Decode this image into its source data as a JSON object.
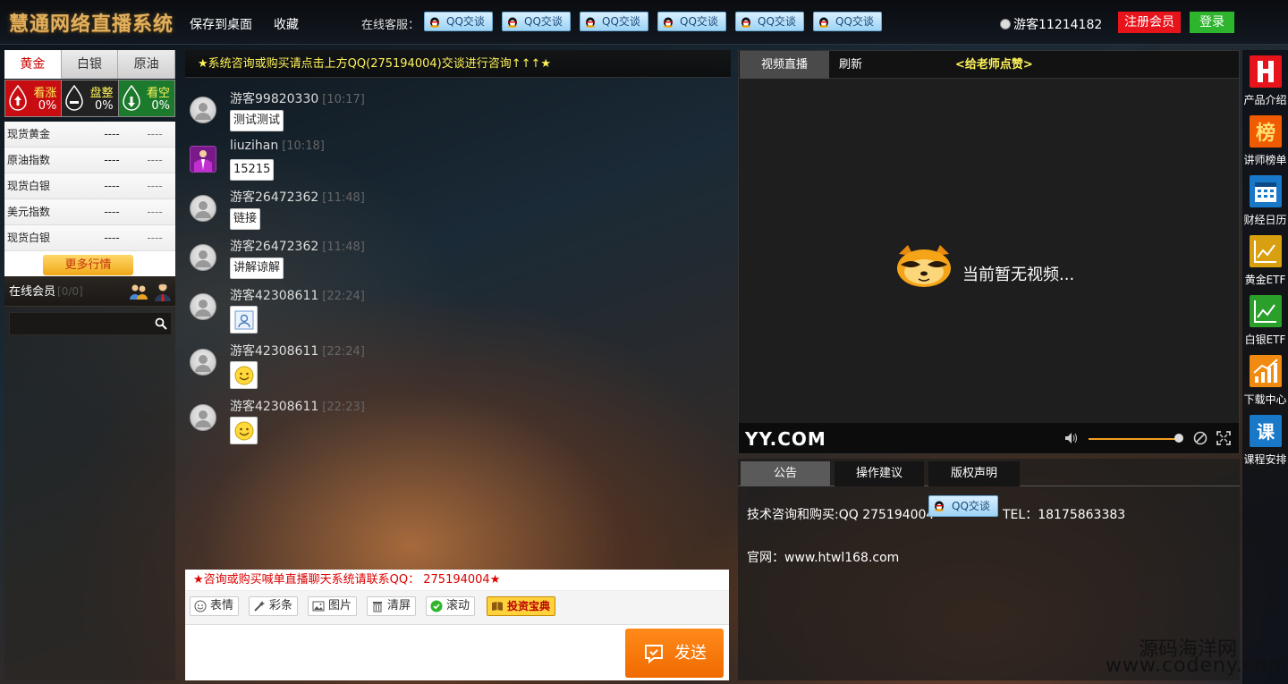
{
  "header": {
    "logo": "慧通网络直播系统",
    "save_desktop": "保存到桌面",
    "favorite": "收藏",
    "online_service_label": "在线客服：",
    "qq_buttons": [
      "QQ交谈",
      "QQ交谈",
      "QQ交谈",
      "QQ交谈",
      "QQ交谈",
      "QQ交谈"
    ],
    "username": "游客11214182",
    "register": "注册会员",
    "login": "登录"
  },
  "market": {
    "tabs": [
      "黄金",
      "白银",
      "原油"
    ],
    "active_tab": 0,
    "sentiment": [
      {
        "label": "看涨",
        "pct": "0%"
      },
      {
        "label": "盘整",
        "pct": "0%"
      },
      {
        "label": "看空",
        "pct": "0%"
      }
    ],
    "quotes": [
      {
        "name": "现货黄金",
        "value": "----",
        "change": "----"
      },
      {
        "name": "原油指数",
        "value": "----",
        "change": "----"
      },
      {
        "name": "现货白银",
        "value": "----",
        "change": "----"
      },
      {
        "name": "美元指数",
        "value": "----",
        "change": "----"
      },
      {
        "name": "现货白银",
        "value": "----",
        "change": "----"
      }
    ],
    "more": "更多行情"
  },
  "members": {
    "title": "在线会员",
    "count": "[0/0]",
    "search_placeholder": ""
  },
  "chat": {
    "notice": "★系统咨询或购买请点击上方QQ(275194004)交谈进行咨询↑↑↑★",
    "messages": [
      {
        "user": "游客99820330",
        "time": "[10:17]",
        "text": "测试测试",
        "type": "text"
      },
      {
        "user": "liuzihan",
        "time": "[10:18]",
        "text": "15215",
        "type": "text"
      },
      {
        "user": "游客26472362",
        "time": "[11:48]",
        "text": "链接",
        "type": "text"
      },
      {
        "user": "游客26472362",
        "time": "[11:48]",
        "text": "讲解谅解",
        "type": "text"
      },
      {
        "user": "游客42308611",
        "time": "[22:24]",
        "text": "",
        "type": "image"
      },
      {
        "user": "游客42308611",
        "time": "[22:24]",
        "text": "",
        "type": "emoji"
      },
      {
        "user": "游客42308611",
        "time": "[22:23]",
        "text": "",
        "type": "emoji"
      }
    ],
    "footer_notice": "★咨询或购买喊单直播聊天系统请联系QQ： 275194004★",
    "tools": [
      "表情",
      "彩条",
      "图片",
      "清屏",
      "滚动",
      "投资宝典"
    ],
    "send": "发送"
  },
  "video": {
    "tab_live": "视频直播",
    "tab_refresh": "刷新",
    "like": "<给老师点赞>",
    "no_video": "当前暂无视频...",
    "brand": "YY.COM",
    "volume": 1.0
  },
  "announce": {
    "tabs": [
      "公告",
      "操作建议",
      "版权声明"
    ],
    "active_tab": 0,
    "line1": "技术咨询和购买:QQ 275194004",
    "qq": "QQ交谈",
    "tel": "TEL：18175863383",
    "line2": "官网：www.htwl168.com"
  },
  "sidebar": {
    "items": [
      {
        "label": "产品介绍",
        "icon": "h-icon",
        "color": "#e8141c"
      },
      {
        "label": "讲师榜单",
        "icon": "rank-icon",
        "color": "#f05a00"
      },
      {
        "label": "财经日历",
        "icon": "calendar-icon",
        "color": "#1a78c8"
      },
      {
        "label": "黄金ETF",
        "icon": "chart-icon",
        "color": "#d8a010"
      },
      {
        "label": "白银ETF",
        "icon": "chart-icon",
        "color": "#2aa02a"
      },
      {
        "label": "下载中心",
        "icon": "trend-icon",
        "color": "#f08a10"
      },
      {
        "label": "课程安排",
        "icon": "course-icon",
        "color": "#1a78c8"
      }
    ]
  },
  "watermark": {
    "line1": "源码海洋网",
    "line2": "www.codeny.com"
  }
}
